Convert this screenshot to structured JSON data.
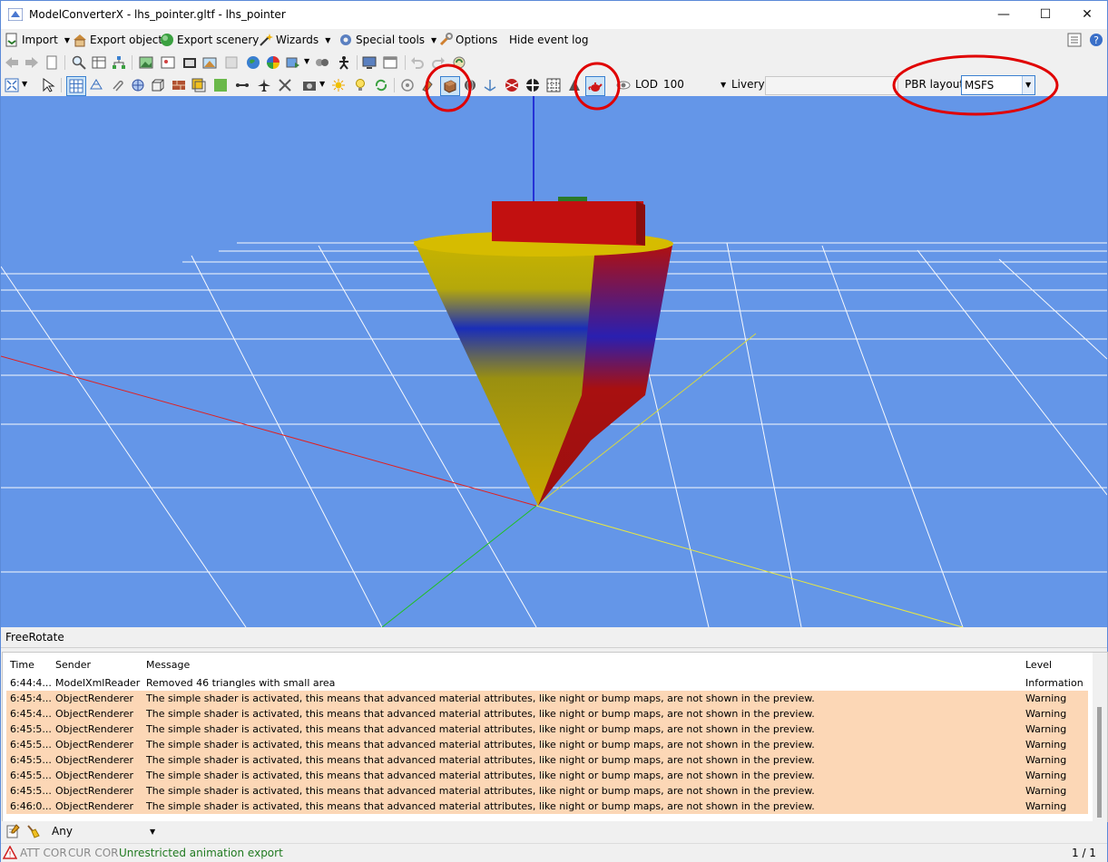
{
  "window": {
    "title": "ModelConverterX - lhs_pointer.gltf - lhs_pointer"
  },
  "menu": {
    "import": "Import",
    "export_object": "Export object",
    "export_scenery": "Export scenery",
    "wizards": "Wizards",
    "special_tools": "Special tools",
    "options": "Options",
    "hide_event_log": "Hide event log"
  },
  "toolbar3": {
    "lod_label": "LOD",
    "lod_value": "100",
    "livery_label": "Livery",
    "livery_value": "",
    "pbr_label": "PBR layout",
    "pbr_value": "MSFS"
  },
  "mode_label": "FreeRotate",
  "log": {
    "headers": {
      "time": "Time",
      "sender": "Sender",
      "message": "Message",
      "level": "Level"
    },
    "rows": [
      {
        "time": "6:44:4...",
        "sender": "ModelXmlReader",
        "message": "Removed 46 triangles with small area",
        "level": "Information"
      },
      {
        "time": "6:45:4...",
        "sender": "ObjectRenderer",
        "message": "The simple shader is activated, this means that advanced material attributes, like night or bump maps, are not shown in the preview.",
        "level": "Warning"
      },
      {
        "time": "6:45:4...",
        "sender": "ObjectRenderer",
        "message": "The simple shader is activated, this means that advanced material attributes, like night or bump maps, are not shown in the preview.",
        "level": "Warning"
      },
      {
        "time": "6:45:5...",
        "sender": "ObjectRenderer",
        "message": "The simple shader is activated, this means that advanced material attributes, like night or bump maps, are not shown in the preview.",
        "level": "Warning"
      },
      {
        "time": "6:45:5...",
        "sender": "ObjectRenderer",
        "message": "The simple shader is activated, this means that advanced material attributes, like night or bump maps, are not shown in the preview.",
        "level": "Warning"
      },
      {
        "time": "6:45:5...",
        "sender": "ObjectRenderer",
        "message": "The simple shader is activated, this means that advanced material attributes, like night or bump maps, are not shown in the preview.",
        "level": "Warning"
      },
      {
        "time": "6:45:5...",
        "sender": "ObjectRenderer",
        "message": "The simple shader is activated, this means that advanced material attributes, like night or bump maps, are not shown in the preview.",
        "level": "Warning"
      },
      {
        "time": "6:45:5...",
        "sender": "ObjectRenderer",
        "message": "The simple shader is activated, this means that advanced material attributes, like night or bump maps, are not shown in the preview.",
        "level": "Warning"
      },
      {
        "time": "6:46:0...",
        "sender": "ObjectRenderer",
        "message": "The simple shader is activated, this means that advanced material attributes, like night or bump maps, are not shown in the preview.",
        "level": "Warning"
      }
    ]
  },
  "filter": {
    "value": "Any"
  },
  "status": {
    "att_cor": "ATT COR",
    "cur_cor": "CUR COR",
    "animation": "Unrestricted animation export",
    "pages": "1 / 1"
  },
  "colors": {
    "viewport": "#6496e8",
    "warning_row": "#fcd7b6",
    "highlight": "#e00000"
  }
}
